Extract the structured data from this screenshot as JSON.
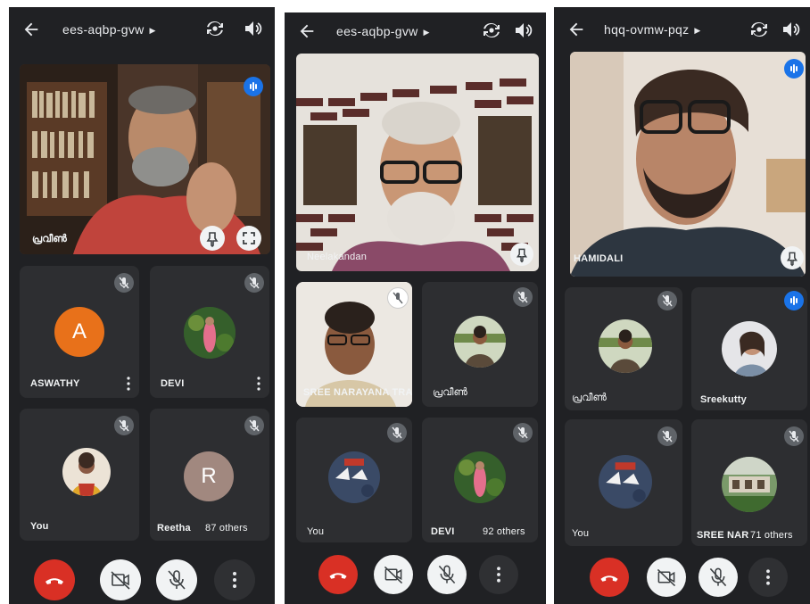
{
  "panels": [
    {
      "meeting_code": "ees-aqbp-gvw",
      "main_name": "പ്രവീൺ",
      "tiles": [
        {
          "name": "ASWATHY",
          "avatar_letter": "A",
          "avatar_color": "#e8711a"
        },
        {
          "name": "DEVI"
        },
        {
          "name": "You"
        },
        {
          "name": "Reetha",
          "avatar_letter": "R",
          "avatar_color": "#a1887f",
          "others": "87 others"
        }
      ]
    },
    {
      "meeting_code": "ees-aqbp-gvw",
      "main_name": "Neelakandan",
      "tiles": [
        {
          "name": "SREE NARAYANA TRA..."
        },
        {
          "name": "പ്രവീൺ"
        },
        {
          "name": "You"
        },
        {
          "name": "DEVI",
          "others": "92 others"
        }
      ]
    },
    {
      "meeting_code": "hqq-ovmw-pqz",
      "main_name": "HAMIDALI",
      "tiles": [
        {
          "name": "പ്രവീൺ"
        },
        {
          "name": "Sreekutty"
        },
        {
          "name": "You"
        },
        {
          "name": "SREE NAR",
          "others": "71 others"
        }
      ]
    }
  ],
  "icons": {
    "back": "arrow-back-icon",
    "switch_camera": "switch-camera-icon",
    "speaker": "speaker-icon",
    "end_call": "call-end-icon",
    "camera_off": "videocam-off-icon",
    "mic_off": "mic-off-icon",
    "more": "more-vert-icon",
    "pin": "pin-icon",
    "fullscreen": "fullscreen-icon",
    "speaking": "audio-level-icon"
  },
  "colors": {
    "background": "#202124",
    "tile": "#2d2e31",
    "end_call": "#d93025",
    "speaking": "#1a73e8"
  }
}
